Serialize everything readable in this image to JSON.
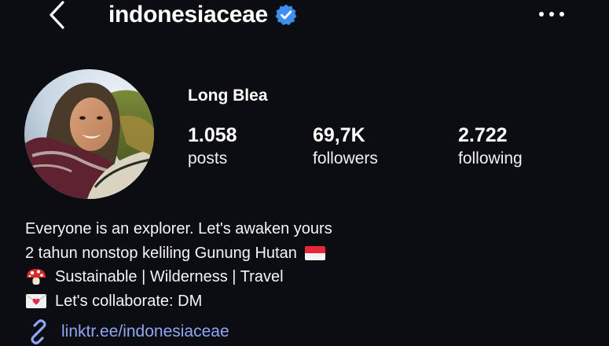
{
  "header": {
    "username": "indonesiaceae",
    "verified": true,
    "back_icon": "chevron-left-icon",
    "more_icon": "more-horizontal-icon"
  },
  "profile": {
    "display_name": "Long Blea",
    "avatar_icon": "profile-photo"
  },
  "stats": [
    {
      "value": "1.058",
      "label": "posts"
    },
    {
      "value": "69,7K",
      "label": "followers"
    },
    {
      "value": "2.722",
      "label": "following"
    }
  ],
  "bio": {
    "line1": "Everyone is an explorer. Let's awaken yours",
    "line2": "2 tahun nonstop keliling Gunung Hutan",
    "line3": "Sustainable | Wilderness | Travel",
    "line4": "Let's collaborate: DM",
    "line2_emoji": "indonesia-flag-icon",
    "line3_emoji": "mushroom-icon",
    "line4_emoji": "love-letter-icon"
  },
  "link": {
    "url": "linktr.ee/indonesiaceae",
    "icon": "link-icon"
  },
  "colors": {
    "background": "#0c0d12",
    "text": "#f5f5f7",
    "link": "#8fa6f2",
    "verified": "#3d8ef0"
  }
}
